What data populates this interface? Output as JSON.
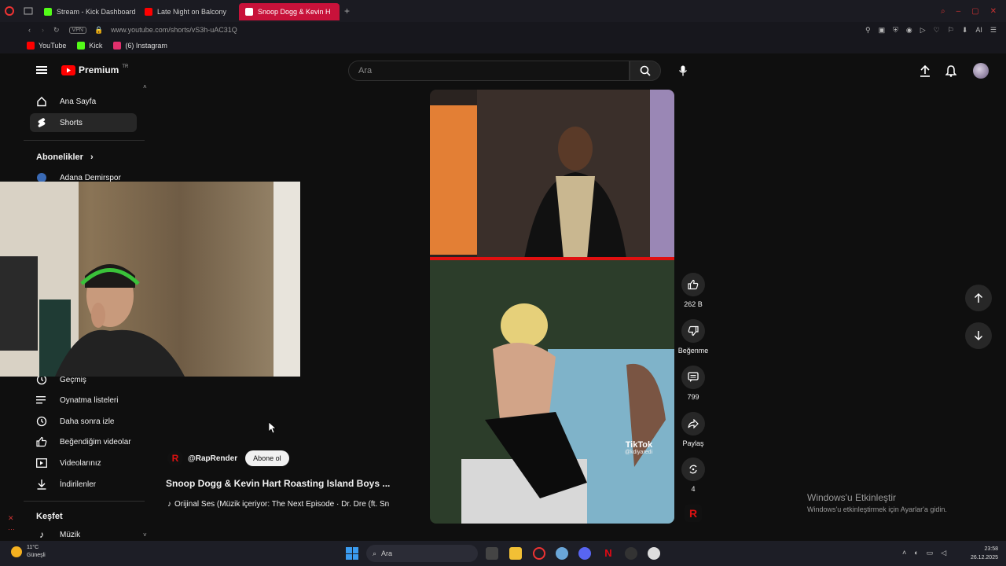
{
  "tabs": [
    {
      "label": "Stream - Kick Dashboard",
      "color": "#53fc18"
    },
    {
      "label": "Late Night on Balcony",
      "color": "#ff0000"
    },
    {
      "label": "Snoop Dogg & Kevin H",
      "color": "#ff0000",
      "active": true
    }
  ],
  "address": {
    "vpn": "VPN",
    "url": "www.youtube.com/shorts/vS3h-uAC31Q"
  },
  "bookmarks": [
    {
      "label": "YouTube",
      "color": "#ff0000"
    },
    {
      "label": "Kick",
      "color": "#53fc18"
    },
    {
      "label": "(6) Instagram",
      "color": "#e1306c"
    }
  ],
  "header": {
    "logo_text": "Premium",
    "region": "TR",
    "search_placeholder": "Ara"
  },
  "sidebar": {
    "top_items": [
      {
        "label": "Ana Sayfa",
        "icon": "home-icon"
      },
      {
        "label": "Shorts",
        "icon": "shorts-icon",
        "active": true
      }
    ],
    "subs_title": "Abonelikler",
    "subs": [
      {
        "label": "Adana Demirspor"
      }
    ],
    "you_items": [
      {
        "label": "Geçmiş",
        "icon": "history-icon"
      },
      {
        "label": "Oynatma listeleri",
        "icon": "playlist-icon"
      },
      {
        "label": "Daha sonra izle",
        "icon": "clock-icon"
      },
      {
        "label": "Beğendiğim videolar",
        "icon": "thumbs-up-icon"
      },
      {
        "label": "Videolarınız",
        "icon": "video-icon"
      },
      {
        "label": "İndirilenler",
        "icon": "download-icon"
      }
    ],
    "explore_title": "Keşfet",
    "explore_items": [
      {
        "label": "Müzik",
        "icon": "music-icon"
      }
    ]
  },
  "short": {
    "channel": "@RapRender",
    "subscribe_label": "Abone ol",
    "title": "Snoop Dogg & Kevin Hart Roasting Island Boys ...",
    "audio": "Orijinal Ses (Müzik içeriyor: The Next Episode · Dr. Dre (ft. Sn",
    "likes": "262 B",
    "dislike_label": "Beğenme",
    "comments": "799",
    "share_label": "Paylaş",
    "remix_count": "4",
    "tiktok_text": "TikTok",
    "tiktok_user": "@kdiyaredi"
  },
  "activation": {
    "title": "Windows'u Etkinleştir",
    "subtitle": "Windows'u etkinleştirmek için Ayarlar'a gidin."
  },
  "taskbar": {
    "weather_temp": "11°C",
    "weather_desc": "Güneşli",
    "search_placeholder": "Ara",
    "time": "23:58",
    "date": "26.12.2025"
  },
  "colors": {
    "accent": "#ff0000",
    "tab_active": "#c8123a"
  }
}
